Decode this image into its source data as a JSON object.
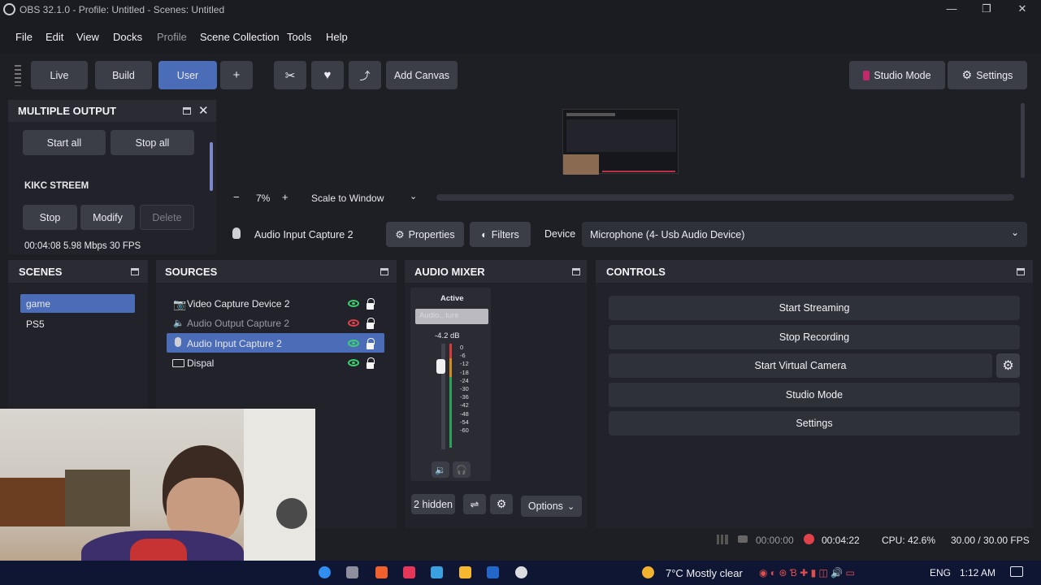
{
  "window": {
    "title": "OBS 32.1.0 - Profile: Untitled - Scenes: Untitled"
  },
  "menu": [
    "File",
    "Edit",
    "View",
    "Docks",
    "Profile",
    "Scene Collection",
    "Tools",
    "Help"
  ],
  "toolbar": {
    "live": "Live",
    "build": "Build",
    "user": "User",
    "plus": "+",
    "add_canvas": "Add Canvas",
    "studio_mode": "Studio Mode",
    "settings": "Settings"
  },
  "multiple_output": {
    "title": "MULTIPLE OUTPUT",
    "start_all": "Start all",
    "stop_all": "Stop all",
    "stream_name": "KIKC STREEM",
    "stop": "Stop",
    "modify": "Modify",
    "delete": "Delete",
    "stats": "00:04:08  5.98 Mbps  30 FPS"
  },
  "preview": {
    "zoom_minus": "−",
    "zoom": "7%",
    "zoom_plus": "+",
    "scale_mode": "Scale to Window"
  },
  "source_bar": {
    "name": "Audio Input Capture 2",
    "properties": "Properties",
    "filters": "Filters",
    "device_label": "Device",
    "device_value": "Microphone (4- Usb Audio Device)"
  },
  "scenes": {
    "title": "SCENES",
    "items": [
      "game",
      "PS5"
    ]
  },
  "sources": {
    "title": "SOURCES",
    "items": [
      "Video Capture Device 2",
      "Audio Output Capture 2",
      "Audio Input Capture 2",
      "Dispal"
    ]
  },
  "audio_mixer": {
    "title": "AUDIO MIXER",
    "channel_state": "Active",
    "channel_name": "Audio...ture",
    "db": "-4.2 dB",
    "scale": [
      "0",
      "-6",
      "-12",
      "-18",
      "-24",
      "-30",
      "-36",
      "-42",
      "-48",
      "-54",
      "-60"
    ],
    "hidden": "2 hidden",
    "options": "Options",
    "volume_level": 0.82
  },
  "controls": {
    "title": "CONTROLS",
    "buttons": [
      "Start Streaming",
      "Stop Recording",
      "Start Virtual Camera",
      "Studio Mode",
      "Settings"
    ]
  },
  "status": {
    "stream_time": "00:00:00",
    "rec_time": "00:04:22",
    "cpu": "CPU: 42.6%",
    "fps": "30.00 / 30.00 FPS"
  },
  "taskbar": {
    "weather": "7°C  Mostly clear",
    "lang": "ENG",
    "time": "1:12 AM"
  },
  "colors": {
    "accent": "#4b6cb7",
    "record": "#e0414a",
    "eye_on": "#3bd16f"
  }
}
